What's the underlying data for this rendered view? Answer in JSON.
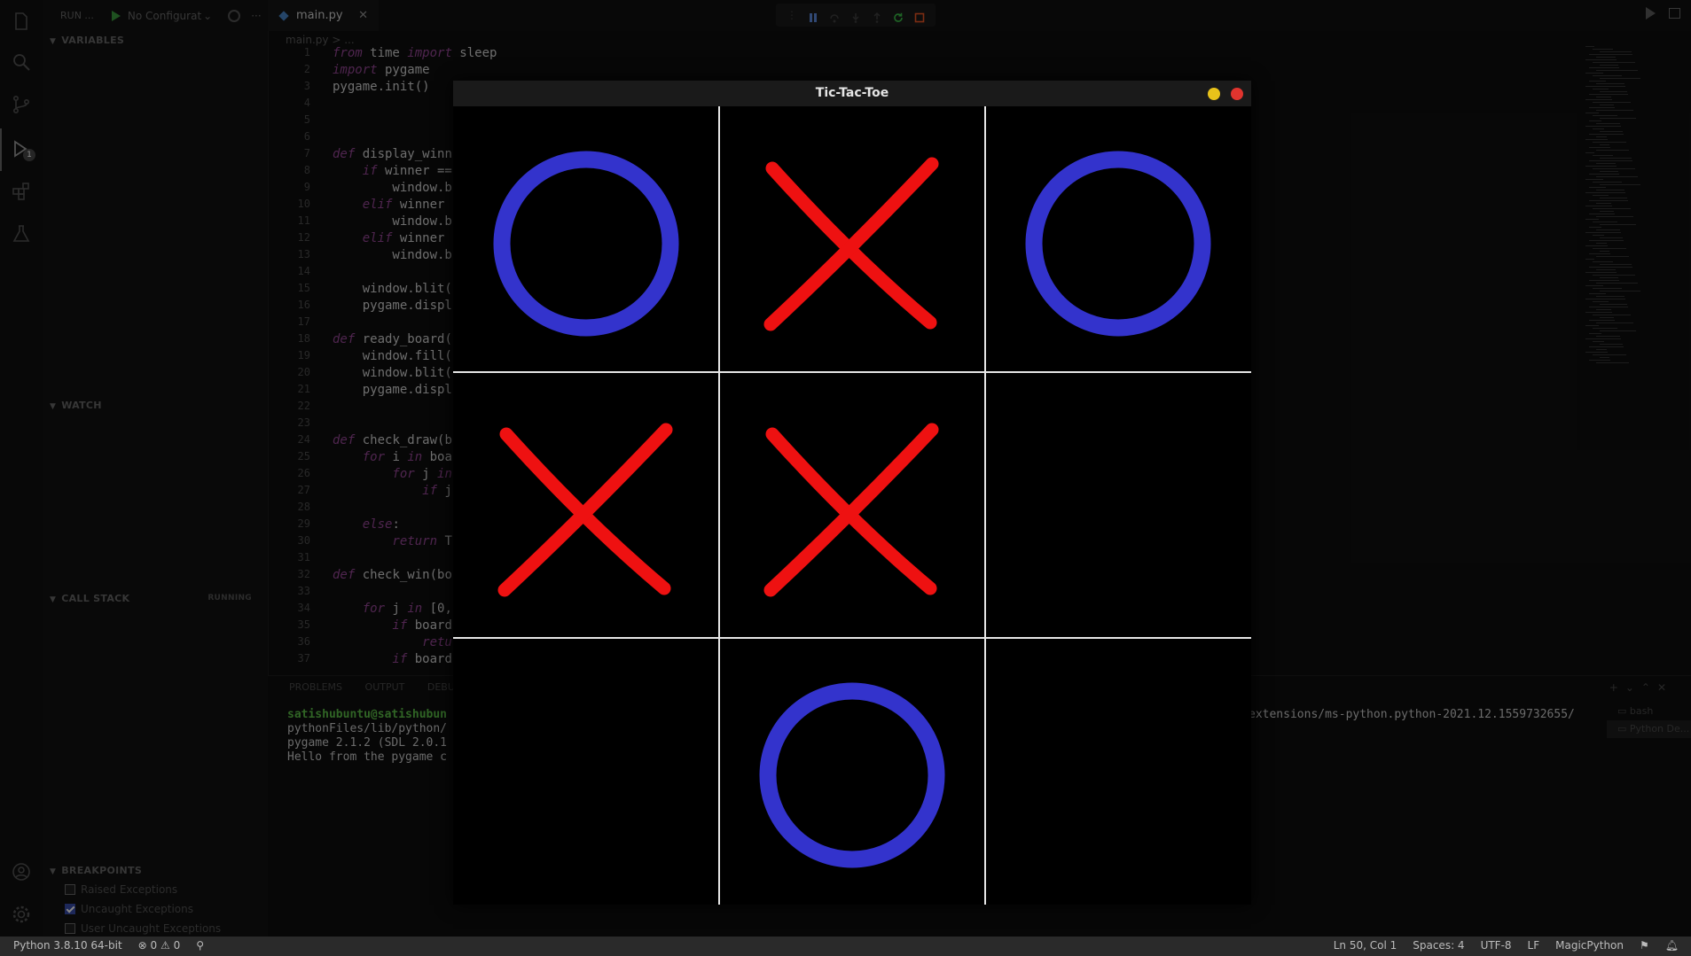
{
  "run_bar": {
    "label": "RUN ...",
    "config": "No Configurat"
  },
  "sidebar": {
    "sections": [
      "VARIABLES",
      "WATCH",
      "CALL STACK",
      "BREAKPOINTS"
    ],
    "call_stack_status": "RUNNING",
    "breakpoints": [
      {
        "label": "Raised Exceptions",
        "checked": false
      },
      {
        "label": "Uncaught Exceptions",
        "checked": true
      },
      {
        "label": "User Uncaught Exceptions",
        "checked": false
      }
    ]
  },
  "activity_bar": {
    "debug_badge": "1"
  },
  "editor": {
    "tab_name": "main.py",
    "breadcrumb": "main.py > ...",
    "lines": [
      {
        "n": "1",
        "kw": "from",
        "t": " time ",
        "kw2": "import",
        "t2": " sleep"
      },
      {
        "n": "2",
        "kw": "import",
        "t": " pygame",
        "kw2": "",
        "t2": ""
      },
      {
        "n": "3",
        "kw": "",
        "t": "pygame.init()",
        "kw2": "",
        "t2": ""
      },
      {
        "n": "4",
        "kw": "",
        "t": "",
        "kw2": "",
        "t2": ""
      },
      {
        "n": "5",
        "kw": "",
        "t": "",
        "kw2": "",
        "t2": ""
      },
      {
        "n": "6",
        "kw": "",
        "t": "",
        "kw2": "",
        "t2": ""
      },
      {
        "n": "7",
        "kw": "def",
        "t": " display_winn",
        "kw2": "",
        "t2": ""
      },
      {
        "n": "8",
        "kw": "    if",
        "t": " winner ==",
        "kw2": "",
        "t2": ""
      },
      {
        "n": "9",
        "kw": "",
        "t": "        window.b",
        "kw2": "",
        "t2": ""
      },
      {
        "n": "10",
        "kw": "    elif",
        "t": " winner",
        "kw2": "",
        "t2": ""
      },
      {
        "n": "11",
        "kw": "",
        "t": "        window.b",
        "kw2": "",
        "t2": ""
      },
      {
        "n": "12",
        "kw": "    elif",
        "t": " winner",
        "kw2": "",
        "t2": ""
      },
      {
        "n": "13",
        "kw": "",
        "t": "        window.b",
        "kw2": "",
        "t2": ""
      },
      {
        "n": "14",
        "kw": "",
        "t": "",
        "kw2": "",
        "t2": ""
      },
      {
        "n": "15",
        "kw": "",
        "t": "    window.blit(",
        "kw2": "",
        "t2": ""
      },
      {
        "n": "16",
        "kw": "",
        "t": "    pygame.displ",
        "kw2": "",
        "t2": ""
      },
      {
        "n": "17",
        "kw": "",
        "t": "",
        "kw2": "",
        "t2": ""
      },
      {
        "n": "18",
        "kw": "def",
        "t": " ready_board(",
        "kw2": "",
        "t2": ""
      },
      {
        "n": "19",
        "kw": "",
        "t": "    window.fill(",
        "kw2": "",
        "t2": ""
      },
      {
        "n": "20",
        "kw": "",
        "t": "    window.blit(",
        "kw2": "",
        "t2": ""
      },
      {
        "n": "21",
        "kw": "",
        "t": "    pygame.displ",
        "kw2": "",
        "t2": ""
      },
      {
        "n": "22",
        "kw": "",
        "t": "",
        "kw2": "",
        "t2": ""
      },
      {
        "n": "23",
        "kw": "",
        "t": "",
        "kw2": "",
        "t2": ""
      },
      {
        "n": "24",
        "kw": "def",
        "t": " check_draw(b",
        "kw2": "",
        "t2": ""
      },
      {
        "n": "25",
        "kw": "    for",
        "t": " i ",
        "kw2": "in",
        "t2": " boa"
      },
      {
        "n": "26",
        "kw": "        for",
        "t": " j ",
        "kw2": "in",
        "t2": ""
      },
      {
        "n": "27",
        "kw": "            if",
        "t": " j",
        "kw2": "",
        "t2": ""
      },
      {
        "n": "28",
        "kw": "",
        "t": "",
        "kw2": "",
        "t2": ""
      },
      {
        "n": "29",
        "kw": "    else",
        "t": ":",
        "kw2": "",
        "t2": ""
      },
      {
        "n": "30",
        "kw": "        return",
        "t": " T",
        "kw2": "",
        "t2": ""
      },
      {
        "n": "31",
        "kw": "",
        "t": "",
        "kw2": "",
        "t2": ""
      },
      {
        "n": "32",
        "kw": "def",
        "t": " check_win(bo",
        "kw2": "",
        "t2": ""
      },
      {
        "n": "33",
        "kw": "",
        "t": "",
        "kw2": "",
        "t2": ""
      },
      {
        "n": "34",
        "kw": "    for",
        "t": " j ",
        "kw2": "in",
        "t2": " [0,"
      },
      {
        "n": "35",
        "kw": "        if",
        "t": " board",
        "kw2": "",
        "t2": ""
      },
      {
        "n": "36",
        "kw": "            retu",
        "t": "",
        "kw2": "",
        "t2": ""
      },
      {
        "n": "37",
        "kw": "        if",
        "t": " board",
        "kw2": "",
        "t2": ""
      }
    ]
  },
  "panel": {
    "tabs": [
      "PROBLEMS",
      "OUTPUT",
      "DEBUG"
    ],
    "terminal_lines": [
      "satishubuntu@satishubun",
      "pythonFiles/lib/python/",
      "pygame 2.1.2 (SDL 2.0.1",
      "Hello from the pygame c"
    ],
    "terminal_right": "extensions/ms-python.python-2021.12.1559732655/",
    "terminals": [
      "bash",
      "Python De..."
    ]
  },
  "statusbar": {
    "interpreter": "Python 3.8.10 64-bit",
    "errors": "0",
    "warnings": "0",
    "cursor": "Ln 50, Col 1",
    "spaces": "Spaces: 4",
    "encoding": "UTF-8",
    "eol": "LF",
    "language": "MagicPython"
  },
  "game": {
    "title": "Tic-Tac-Toe",
    "board": [
      "O",
      "X",
      "O",
      "X",
      "X",
      "",
      "",
      "O",
      ""
    ],
    "colors": {
      "o": "#3333cc",
      "x": "#ee1111",
      "grid": "#e6e6e6"
    }
  }
}
